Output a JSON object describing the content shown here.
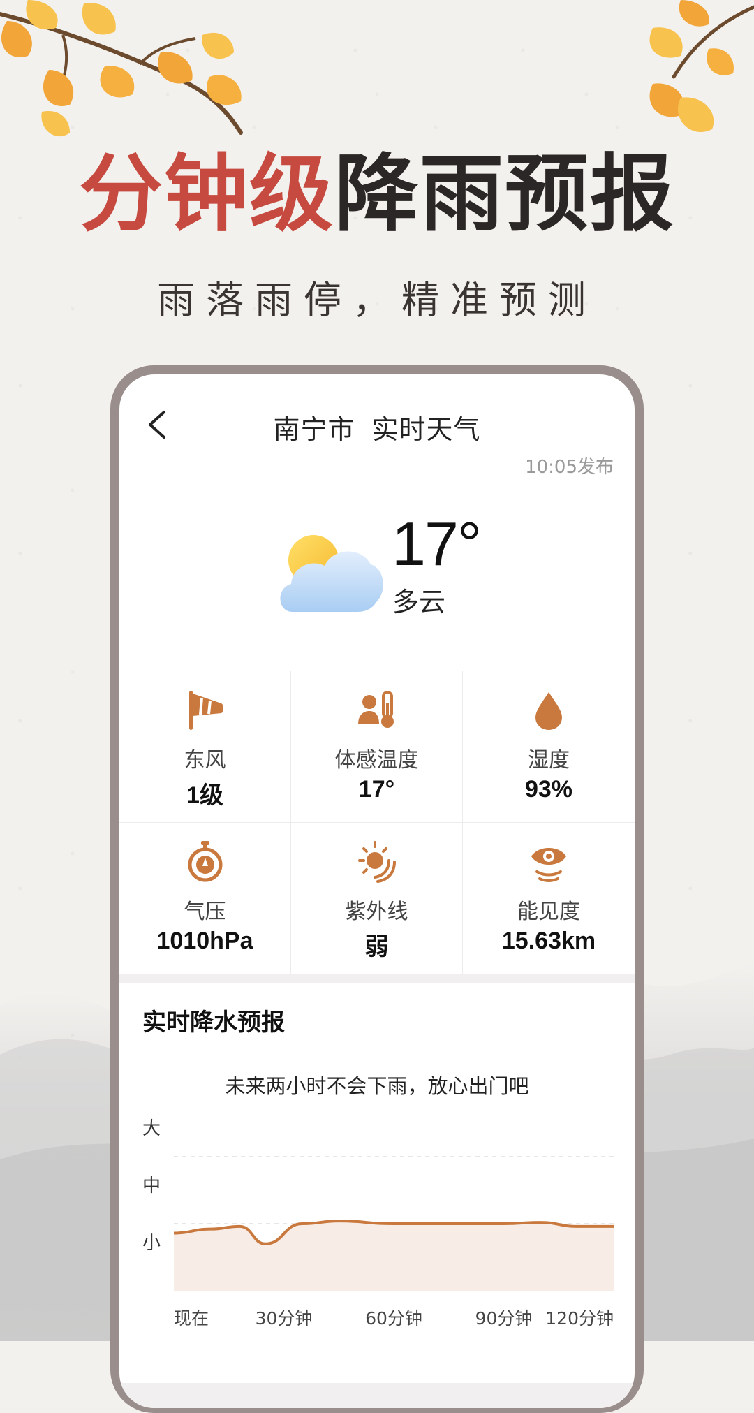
{
  "headline": {
    "red": "分钟级",
    "dark": "降雨预报"
  },
  "subline": "雨落雨停，精准预测",
  "colors": {
    "accent": "#c9793d",
    "headline_red": "#c64a3f",
    "frame": "#9a8e8c"
  },
  "nav": {
    "back_icon": "chevron-left-icon",
    "city": "南宁市",
    "title": "实时天气"
  },
  "published": "10:05发布",
  "current": {
    "icon": "partly-cloudy-icon",
    "temp": "17°",
    "condition": "多云"
  },
  "details": [
    {
      "icon": "windsock-icon",
      "label": "东风",
      "value": "1级"
    },
    {
      "icon": "person-thermometer-icon",
      "label": "体感温度",
      "value": "17°"
    },
    {
      "icon": "droplet-icon",
      "label": "湿度",
      "value": "93%"
    },
    {
      "icon": "stopwatch-icon",
      "label": "气压",
      "value": "1010hPa"
    },
    {
      "icon": "sun-rays-icon",
      "label": "紫外线",
      "value": "弱"
    },
    {
      "icon": "eye-icon",
      "label": "能见度",
      "value": "15.63km"
    }
  ],
  "precip": {
    "title": "实时降水预报",
    "note": "未来两小时不会下雨，放心出门吧"
  },
  "chart_data": {
    "type": "area",
    "y_levels": [
      "大",
      "中",
      "小"
    ],
    "x_labels": [
      "现在",
      "30分钟",
      "60分钟",
      "90分钟",
      "120分钟"
    ],
    "x": [
      0,
      10,
      18,
      25,
      35,
      45,
      60,
      75,
      90,
      100,
      110,
      120
    ],
    "values": [
      0.43,
      0.46,
      0.48,
      0.35,
      0.5,
      0.52,
      0.5,
      0.5,
      0.5,
      0.51,
      0.48,
      0.48
    ],
    "xlim": [
      0,
      120
    ],
    "ylim": [
      0,
      1
    ],
    "grid": true
  }
}
